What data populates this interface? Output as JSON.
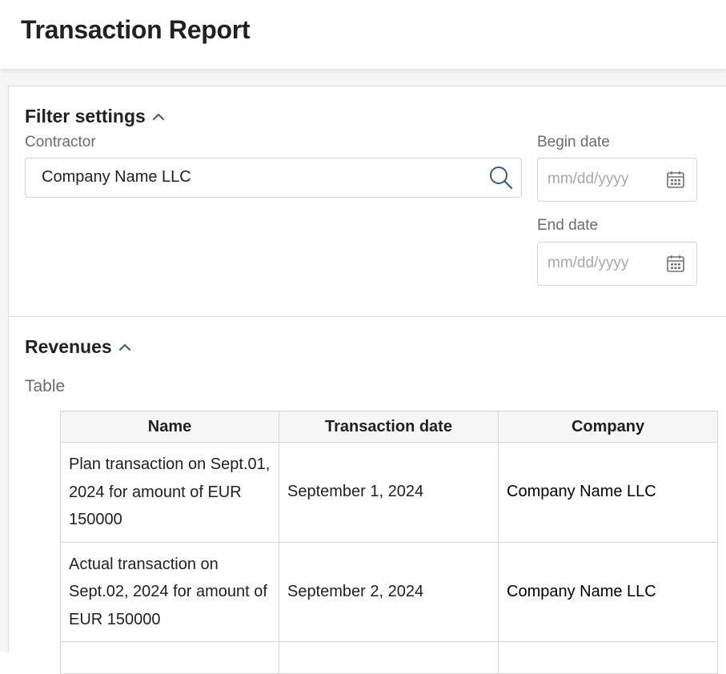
{
  "header": {
    "title": "Transaction Report"
  },
  "filter_settings": {
    "title": "Filter settings",
    "contractor": {
      "label": "Contractor",
      "value": "Company Name LLC"
    },
    "begin_date": {
      "label": "Begin date",
      "placeholder": "mm/dd/yyyy"
    },
    "end_date": {
      "label": "End date",
      "placeholder": "mm/dd/yyyy"
    }
  },
  "revenues": {
    "title": "Revenues",
    "table_label": "Table",
    "columns": [
      "Name",
      "Transaction date",
      "Company"
    ],
    "rows": [
      {
        "name": "Plan transaction on Sept.01, 2024 for amount of EUR 150000",
        "date": "September 1, 2024",
        "company": "Company Name LLC"
      },
      {
        "name": "Actual transaction on Sept.02, 2024 for amount of EUR 150000",
        "date": "September 2, 2024",
        "company": "Company Name LLC"
      }
    ]
  },
  "icons": [
    "chevron-up-icon",
    "search-icon",
    "calendar-icon"
  ],
  "colors": {
    "accent": "#2d5c8a",
    "header_bg": "#ffffff",
    "content_bg": "#f5f5f5"
  }
}
